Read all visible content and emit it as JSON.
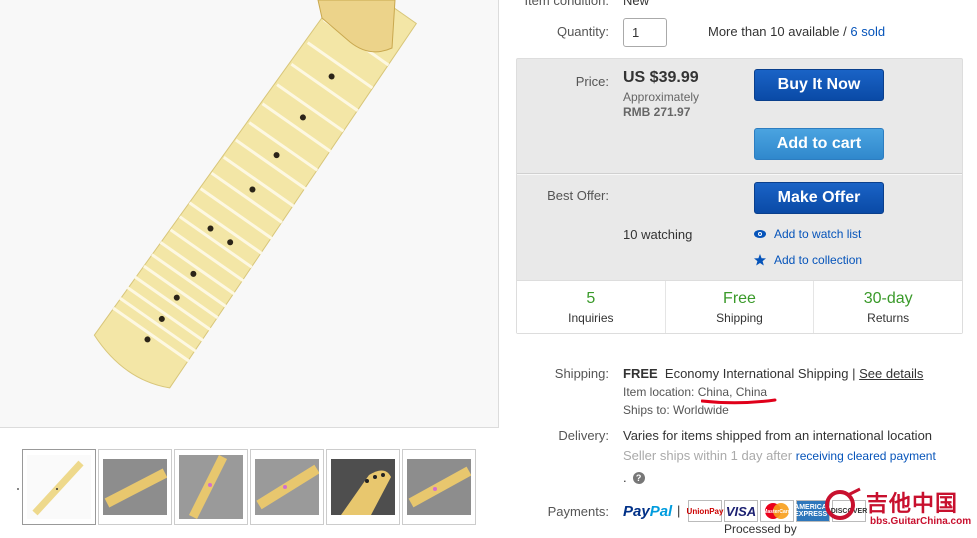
{
  "item": {
    "condition_label": "Item condition:",
    "condition_value": "New",
    "quantity_label": "Quantity:",
    "quantity_value": "1",
    "availability": "More than 10 available /",
    "sold_link": "6 sold"
  },
  "buybox": {
    "price_label": "Price:",
    "price": "US $39.99",
    "approx_line1": "Approximately",
    "approx_line2": "RMB 271.97",
    "buy_now": "Buy It Now",
    "add_to_cart": "Add to cart",
    "best_offer_label": "Best Offer:",
    "make_offer": "Make Offer",
    "watching": "10 watching",
    "add_watch": "Add to watch list",
    "add_collection": "Add to collection"
  },
  "stats": [
    {
      "big": "5",
      "small": "Inquiries"
    },
    {
      "big": "Free",
      "small": "Shipping"
    },
    {
      "big": "30-day",
      "small": "Returns"
    }
  ],
  "shipping": {
    "label": "Shipping:",
    "free": "FREE",
    "method": "Economy International Shipping |",
    "details_link": "See details",
    "location_label": "Item location:",
    "location": "China, China",
    "ships_to": "Ships to:  Worldwide"
  },
  "delivery": {
    "label": "Delivery:",
    "text": "Varies for items shipped from an international location",
    "seller_ships": "Seller ships within 1 day after",
    "cleared_link": "receiving cleared payment",
    "dot": ".",
    "help": "?"
  },
  "payments": {
    "label": "Payments:",
    "paypal_a": "Pay",
    "paypal_b": "Pal",
    "pipe": "|",
    "cards": [
      "UnionPay",
      "VISA",
      "MasterCard",
      "AMERICAN EXPRESS",
      "DISCOVER"
    ],
    "processed_by": "Processed by"
  },
  "watermark": {
    "title": "吉他中国",
    "subtitle": "bbs.GuitarChina.com"
  },
  "thumbnails": [
    "neck-full",
    "neck-angle-1",
    "neck-angle-2",
    "neck-angle-3",
    "headstock-closeup",
    "neck-angle-4"
  ],
  "colors": {
    "link": "#0654ba",
    "buy_button": "#0a4aa6",
    "cart_button": "#3088cc",
    "green": "#3a9a2a",
    "underline_red": "#e0001a"
  }
}
